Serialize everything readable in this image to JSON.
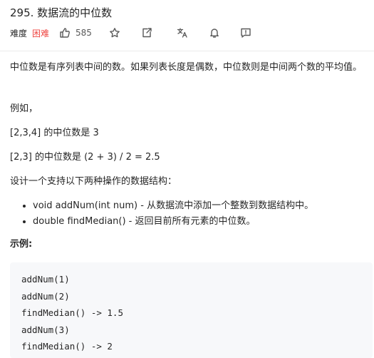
{
  "problem": {
    "title": "295. 数据流的中位数",
    "difficulty_label": "难度",
    "difficulty": "困难",
    "likes": "585"
  },
  "toolbar": {
    "icons": [
      "thumbs-up-icon",
      "star-icon",
      "share-icon",
      "translate-icon",
      "bell-icon",
      "feedback-icon"
    ]
  },
  "description": {
    "p1": "中位数是有序列表中间的数。如果列表长度是偶数，中位数则是中间两个数的平均值。",
    "p2": "例如，",
    "p3": "[2,3,4] 的中位数是 3",
    "p4": "[2,3] 的中位数是 (2 + 3) / 2 = 2.5",
    "p5": "设计一个支持以下两种操作的数据结构：",
    "operations": [
      "void addNum(int num) - 从数据流中添加一个整数到数据结构中。",
      "double findMedian() - 返回目前所有元素的中位数。"
    ],
    "example_title": "示例:"
  },
  "example_code": [
    "addNum(1)",
    "addNum(2)",
    "findMedian() -> 1.5",
    "addNum(3)",
    "findMedian() -> 2"
  ],
  "colors": {
    "difficulty_hard": "#ef4743",
    "text": "#262626",
    "code_bg": "#f7f8fa"
  }
}
